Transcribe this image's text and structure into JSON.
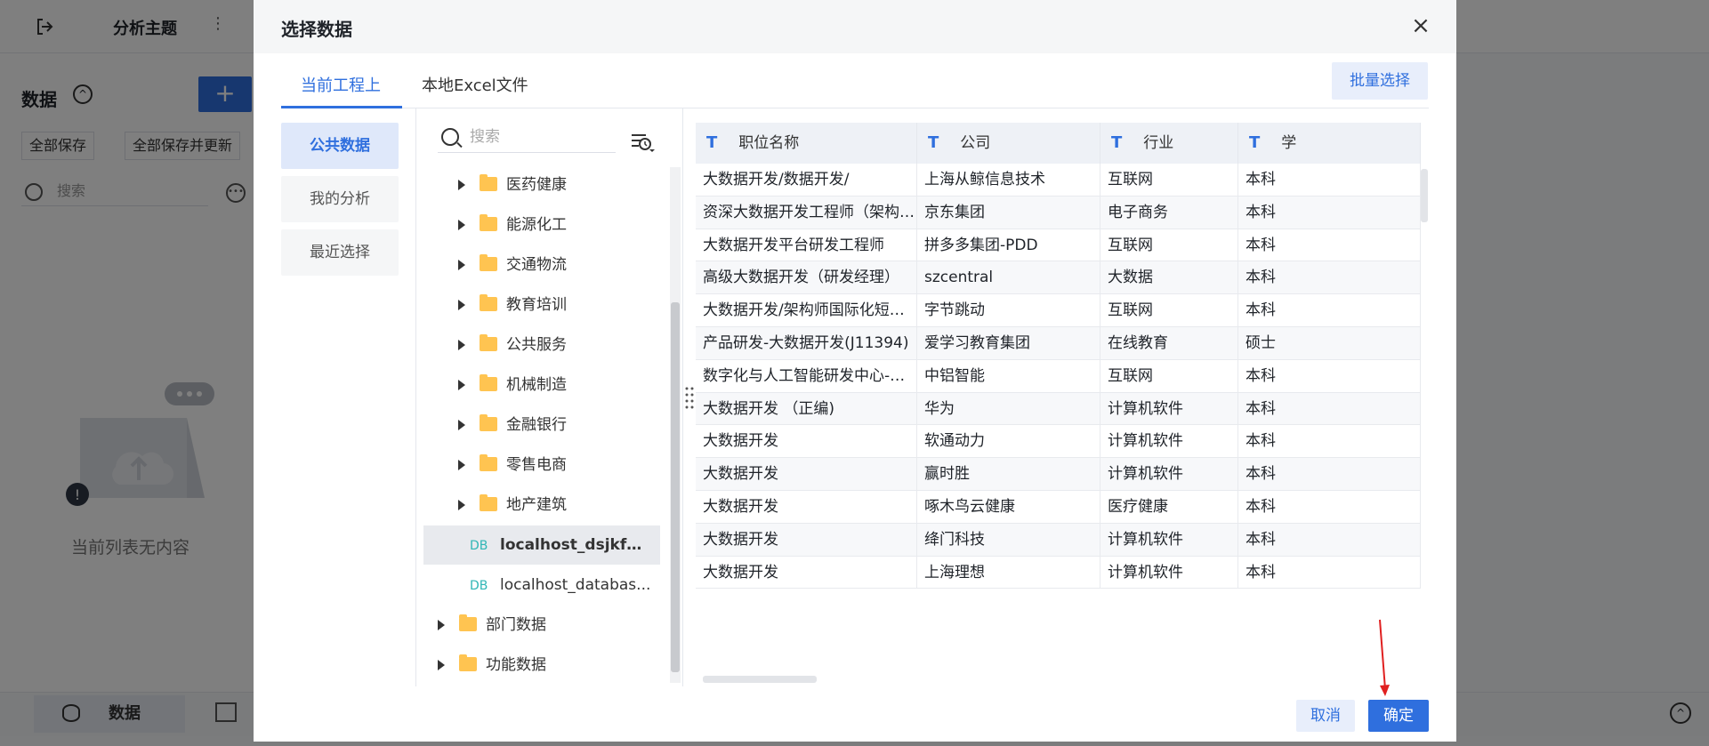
{
  "background": {
    "topbar": {
      "title": "分析主题"
    },
    "sidebar": {
      "title": "数据",
      "add_label": "+",
      "save_all_label": "全部保存",
      "save_update_label": "全部保存并更新",
      "search_placeholder": "搜索",
      "empty_text": "当前列表无内容"
    },
    "bottom_tab": {
      "label": "数据"
    }
  },
  "dialog": {
    "title": "选择数据",
    "close_label": "×",
    "tabs": [
      "当前工程上",
      "本地Excel文件"
    ],
    "batch_select_label": "批量选择",
    "nav": [
      "公共数据",
      "我的分析",
      "最近选择"
    ],
    "tree": {
      "search_placeholder": "搜索",
      "items": [
        {
          "label": "医药健康",
          "type": "folder"
        },
        {
          "label": "能源化工",
          "type": "folder"
        },
        {
          "label": "交通物流",
          "type": "folder"
        },
        {
          "label": "教育培训",
          "type": "folder"
        },
        {
          "label": "公共服务",
          "type": "folder"
        },
        {
          "label": "机械制造",
          "type": "folder"
        },
        {
          "label": "金融银行",
          "type": "folder"
        },
        {
          "label": "零售电商",
          "type": "folder"
        },
        {
          "label": "地产建筑",
          "type": "folder"
        },
        {
          "label": "localhost_dsjkfd...",
          "type": "db",
          "tag": "DB",
          "selected": true
        },
        {
          "label": "localhost_databas...",
          "type": "db",
          "tag": "DB"
        },
        {
          "label": "部门数据",
          "type": "folder",
          "level": 0
        },
        {
          "label": "功能数据",
          "type": "folder",
          "level": 0
        }
      ]
    },
    "table": {
      "type_icon": "T",
      "columns": [
        "职位名称",
        "公司",
        "行业",
        "学"
      ],
      "rows": [
        [
          "大数据开发/数据开发/",
          "上海从鲸信息技术",
          "互联网",
          "本科"
        ],
        [
          "资深大数据开发工程师（架构师 o...",
          "京东集团",
          "电子商务",
          "本科"
        ],
        [
          "大数据开发平台研发工程师",
          "拼多多集团-PDD",
          "互联网",
          "本科"
        ],
        [
          "高级大数据开发（研发经理）",
          "szcentral",
          "大数据",
          "本科"
        ],
        [
          "大数据开发/架构师国际化短视频",
          "字节跳动",
          "互联网",
          "本科"
        ],
        [
          "产品研发-大数据开发(J11394)",
          "爱学习教育集团",
          "在线教育",
          "硕士"
        ],
        [
          "数字化与人工智能研发中心-大数...",
          "中铝智能",
          "互联网",
          "本科"
        ],
        [
          "大数据开发 （正编)",
          "华为",
          "计算机软件",
          "本科"
        ],
        [
          "大数据开发",
          "软通动力",
          "计算机软件",
          "本科"
        ],
        [
          "大数据开发",
          "赢时胜",
          "计算机软件",
          "本科"
        ],
        [
          "大数据开发",
          "啄木鸟云健康",
          "医疗健康",
          "本科"
        ],
        [
          "大数据开发",
          "绛门科技",
          "计算机软件",
          "本科"
        ],
        [
          "大数据开发",
          "上海理想",
          "计算机软件",
          "本科"
        ]
      ]
    },
    "cancel_label": "取消",
    "ok_label": "确定"
  },
  "colors": {
    "accent": "#2f6fde",
    "folder": "#ffc451",
    "db_tag": "#30b6b6",
    "annotation": "#e02020"
  }
}
